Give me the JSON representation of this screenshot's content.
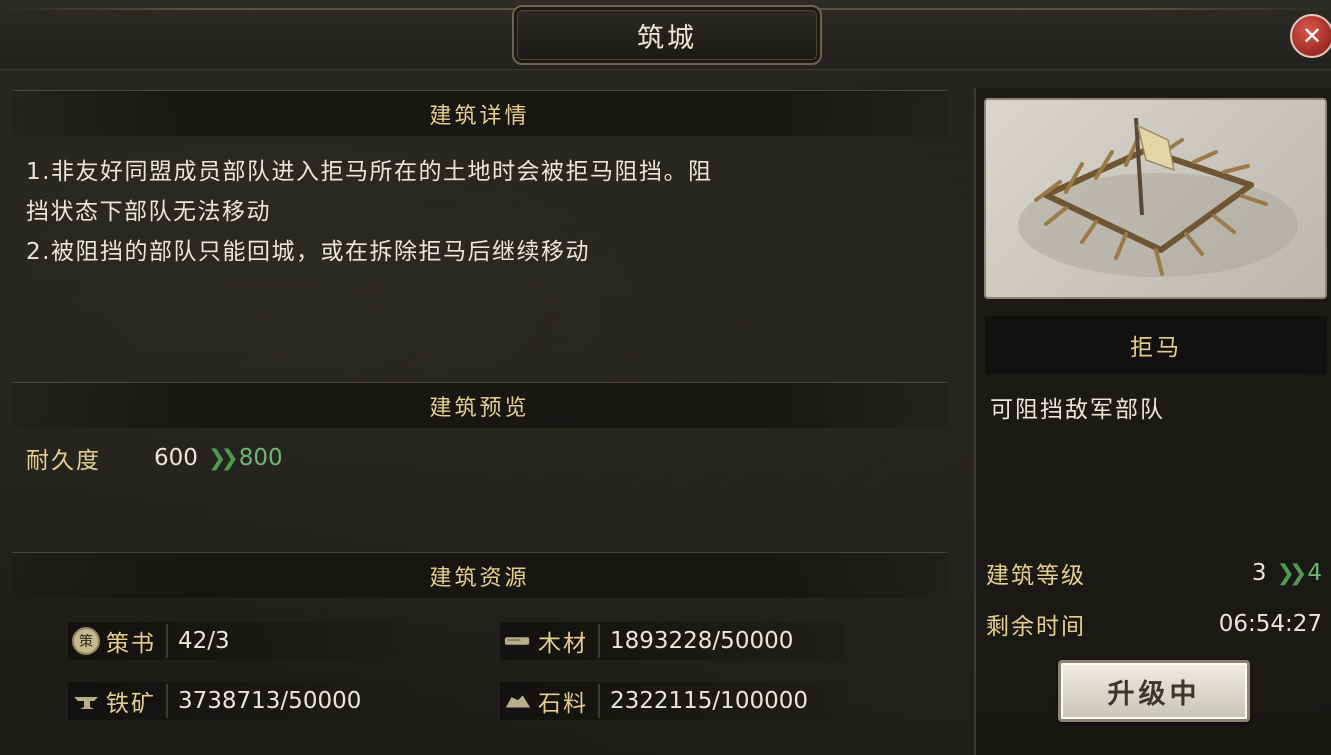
{
  "window": {
    "title": "筑城",
    "close_icon": "close-x"
  },
  "details": {
    "heading": "建筑详情",
    "lines": [
      "1.非友好同盟成员部队进入拒马所在的土地时会被拒马阻挡。阻",
      "挡状态下部队无法移动",
      "2.被阻挡的部队只能回城，或在拆除拒马后继续移动"
    ]
  },
  "preview": {
    "heading": "建筑预览",
    "durability_label": "耐久度",
    "durability_current": "600",
    "durability_next": "800"
  },
  "resources": {
    "heading": "建筑资源",
    "items": [
      {
        "icon": "ce-book-icon",
        "icon_char": "策",
        "name": "策书",
        "value": "42/3"
      },
      {
        "icon": "wood-icon",
        "name": "木材",
        "value": "1893228/50000"
      },
      {
        "icon": "iron-icon",
        "name": "铁矿",
        "value": "3738713/50000"
      },
      {
        "icon": "stone-icon",
        "name": "石料",
        "value": "2322115/100000"
      }
    ]
  },
  "building": {
    "name": "拒马",
    "description": "可阻挡敌军部队",
    "level_label": "建筑等级",
    "level_current": "3",
    "level_next": "4",
    "time_label": "剩余时间",
    "time_value": "06:54:27",
    "upgrade_button": "升级中"
  },
  "colors": {
    "gold_text": "#e6cf8e",
    "green_up": "#6db573",
    "close_red": "#c0433a"
  }
}
